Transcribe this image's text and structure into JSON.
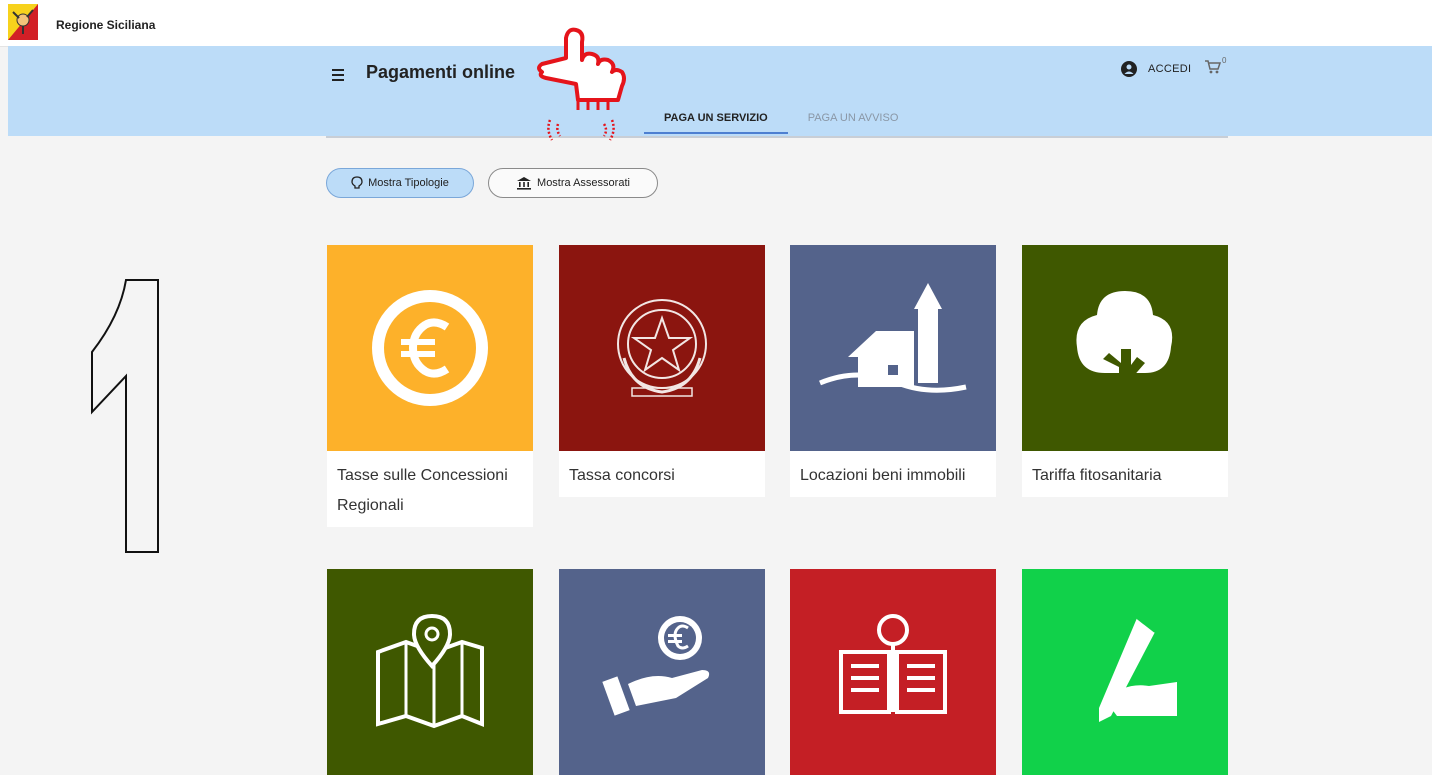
{
  "brand": {
    "name": "Regione Siciliana"
  },
  "header": {
    "title": "Pagamenti online",
    "login_label": "ACCEDI",
    "cart_count": "0",
    "tabs": [
      {
        "label": "PAGA UN SERVIZIO",
        "active": true
      },
      {
        "label": "PAGA UN AVVISO",
        "active": false
      }
    ]
  },
  "filters": {
    "tipologie_label": "Mostra Tipologie",
    "assessorati_label": "Mostra Assessorati"
  },
  "annotation": {
    "step_number": "1"
  },
  "tiles": [
    {
      "label": "Tasse sulle Concessioni Regionali",
      "color": "#fdb12a",
      "icon": "euro-coin-icon"
    },
    {
      "label": "Tassa concorsi",
      "color": "#8b150f",
      "icon": "italian-emblem-icon"
    },
    {
      "label": "Locazioni beni immobili",
      "color": "#54638b",
      "icon": "house-icon"
    },
    {
      "label": "Tariffa fitosanitaria",
      "color": "#3f5800",
      "icon": "tree-icon"
    },
    {
      "label": "",
      "color": "#3f5800",
      "icon": "map-pin-icon"
    },
    {
      "label": "",
      "color": "#54638b",
      "icon": "hand-euro-icon"
    },
    {
      "label": "",
      "color": "#c41f25",
      "icon": "open-book-icon"
    },
    {
      "label": "",
      "color": "#11d14a",
      "icon": "hand-pen-icon"
    }
  ],
  "colors": {
    "header_bg": "#bcdcf8",
    "active_tab_underline": "#4d7fd1",
    "hand_annotation": "#e5141b"
  }
}
